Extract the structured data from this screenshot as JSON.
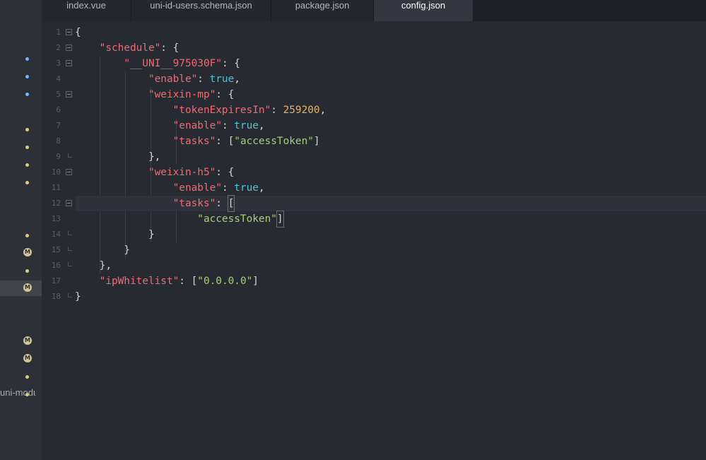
{
  "sidebar": {
    "markers": [
      {
        "kind": "dot",
        "color": "blue"
      },
      {
        "kind": "dot",
        "color": "blue"
      },
      {
        "kind": "dot",
        "color": "blue"
      },
      {
        "kind": "dot",
        "color": "yellow"
      },
      {
        "kind": "dot",
        "color": "yellow"
      },
      {
        "kind": "dot",
        "color": "yellow"
      },
      {
        "kind": "dot",
        "color": "yellow"
      },
      {
        "kind": "dot",
        "color": "yellow"
      },
      {
        "kind": "badge",
        "label": "M"
      },
      {
        "kind": "dot",
        "color": "yellow"
      },
      {
        "kind": "badge",
        "label": "M"
      },
      {
        "kind": "badge",
        "label": "M"
      },
      {
        "kind": "badge",
        "label": "M"
      },
      {
        "kind": "dot",
        "color": "yellow"
      }
    ],
    "partial_label": "uni-modu"
  },
  "tabs": [
    "index.vue",
    "uni-id-users.schema.json",
    "package.json",
    "config.json"
  ],
  "active_tab": "config.json",
  "current_line": 12,
  "code_lines": [
    [
      {
        "t": "p",
        "v": "{"
      }
    ],
    [
      {
        "t": "p",
        "v": "    "
      },
      {
        "t": "k",
        "v": "\"schedule\""
      },
      {
        "t": "p",
        "v": ": {"
      }
    ],
    [
      {
        "t": "p",
        "v": "        "
      },
      {
        "t": "k",
        "v": "\"__UNI__975030F\""
      },
      {
        "t": "p",
        "v": ": {"
      }
    ],
    [
      {
        "t": "p",
        "v": "            "
      },
      {
        "t": "k",
        "v": "\"enable\""
      },
      {
        "t": "p",
        "v": ": "
      },
      {
        "t": "b",
        "v": "true"
      },
      {
        "t": "p",
        "v": ","
      }
    ],
    [
      {
        "t": "p",
        "v": "            "
      },
      {
        "t": "k",
        "v": "\"weixin-mp\""
      },
      {
        "t": "p",
        "v": ": {"
      }
    ],
    [
      {
        "t": "p",
        "v": "                "
      },
      {
        "t": "k",
        "v": "\"tokenExpiresIn\""
      },
      {
        "t": "p",
        "v": ": "
      },
      {
        "t": "n",
        "v": "259200"
      },
      {
        "t": "p",
        "v": ","
      }
    ],
    [
      {
        "t": "p",
        "v": "                "
      },
      {
        "t": "k",
        "v": "\"enable\""
      },
      {
        "t": "p",
        "v": ": "
      },
      {
        "t": "b",
        "v": "true"
      },
      {
        "t": "p",
        "v": ","
      }
    ],
    [
      {
        "t": "p",
        "v": "                "
      },
      {
        "t": "k",
        "v": "\"tasks\""
      },
      {
        "t": "p",
        "v": ": ["
      },
      {
        "t": "s",
        "v": "\"accessToken\""
      },
      {
        "t": "p",
        "v": "]"
      }
    ],
    [
      {
        "t": "p",
        "v": "            },"
      }
    ],
    [
      {
        "t": "p",
        "v": "            "
      },
      {
        "t": "k",
        "v": "\"weixin-h5\""
      },
      {
        "t": "p",
        "v": ": {"
      }
    ],
    [
      {
        "t": "p",
        "v": "                "
      },
      {
        "t": "k",
        "v": "\"enable\""
      },
      {
        "t": "p",
        "v": ": "
      },
      {
        "t": "b",
        "v": "true"
      },
      {
        "t": "p",
        "v": ","
      }
    ],
    [
      {
        "t": "p",
        "v": "                "
      },
      {
        "t": "k",
        "v": "\"tasks\""
      },
      {
        "t": "p",
        "v": ": "
      },
      {
        "t": "c",
        "v": "["
      }
    ],
    [
      {
        "t": "p",
        "v": "                    "
      },
      {
        "t": "s",
        "v": "\"accessToken\""
      },
      {
        "t": "c",
        "v": "]"
      }
    ],
    [
      {
        "t": "p",
        "v": "            }"
      }
    ],
    [
      {
        "t": "p",
        "v": "        }"
      }
    ],
    [
      {
        "t": "p",
        "v": "    },"
      }
    ],
    [
      {
        "t": "p",
        "v": "    "
      },
      {
        "t": "k",
        "v": "\"ipWhitelist\""
      },
      {
        "t": "p",
        "v": ": ["
      },
      {
        "t": "s",
        "v": "\"0.0.0.0\""
      },
      {
        "t": "p",
        "v": "]"
      }
    ],
    [
      {
        "t": "p",
        "v": "}"
      }
    ]
  ],
  "fold_open_lines": [
    1,
    2,
    3,
    5,
    10,
    12
  ],
  "fold_end_lines": [
    9,
    14,
    15,
    16,
    18
  ]
}
